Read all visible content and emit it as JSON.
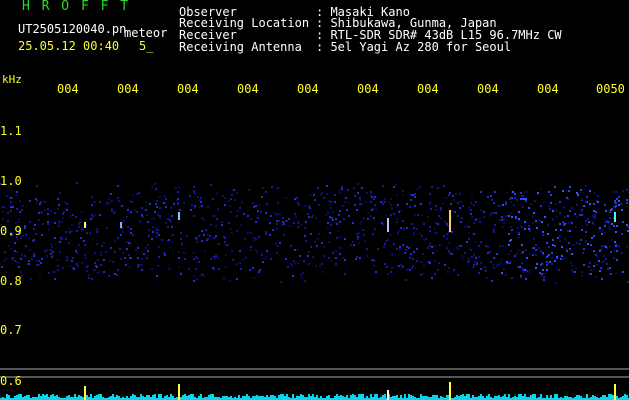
{
  "header": {
    "app_name": "H R O F F T",
    "file_name": "UT2505120040.pn",
    "tag": "meteor",
    "datetime": "25.05.12 00:40",
    "count": "5_",
    "info": [
      {
        "label": "Observer",
        "value": ": Masaki Kano"
      },
      {
        "label": "Receiving Location",
        "value": ": Shibukawa, Gunma, Japan"
      },
      {
        "label": "Receiver",
        "value": ": RTL-SDR SDR# 43dB L15 96.7MHz CW"
      },
      {
        "label": "Receiving Antenna",
        "value": ": 5el Yagi Az 280 for Seoul"
      }
    ]
  },
  "axis": {
    "y_unit": "kHz",
    "y_ticks": [
      "1.1",
      "1.0",
      "0.9",
      "0.8",
      "0.7",
      "0.6"
    ],
    "x_ticks": [
      "004",
      "004",
      "004",
      "004",
      "004",
      "004",
      "004",
      "004",
      "004",
      "0050"
    ]
  },
  "colors": {
    "label": "#ffff22",
    "title": "#22dd22",
    "signal": "#2244ff",
    "strip": "#00e5ff"
  }
}
